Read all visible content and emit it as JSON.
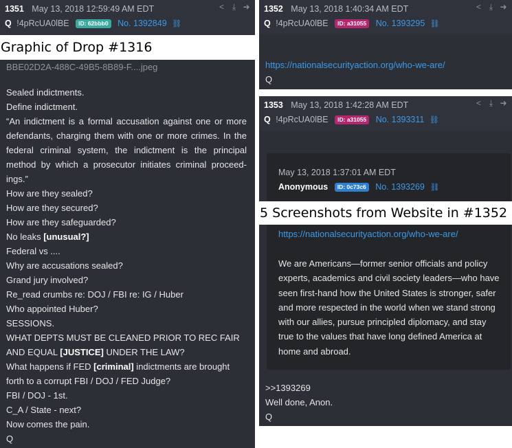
{
  "left_post": {
    "number": "1351",
    "datetime": "May 13, 2018 12:59:49 AM EDT",
    "author": "Q",
    "tripcode": "!4pRcUA0lBE",
    "id_badge": "ID: 62bbb0",
    "id_color": "#3aa99f",
    "post_link": "No. 1392849",
    "filename": "BBE02D2A-488C-49B5-8B89-F....jpeg",
    "lines": {
      "l1": "Sealed indictments.",
      "l2": "Define indictment.",
      "l3": "“An indictment is a formal accusation against one or more defendants, charging them with one or more crimes. In the federal criminal system, the indictment is the principal method by which a prosecutor initiates criminal proceed- ings.”",
      "l4": "How are they sealed?",
      "l5": "How are they secured?",
      "l6": "How are they safeguarded?",
      "l7a": "No leaks ",
      "l7b": "[unusual?]",
      "l8": "Federal vs ....",
      "l9": "Why are accusations sealed?",
      "l10": "Grand jury involved?",
      "l11": "Re_read crumbs re: DOJ / FBI re: IG / Huber",
      "l12": "Who appointed Huber?",
      "l13": "SESSIONS.",
      "l14a": "WHAT DEPTS MUST BE CLEANED PRIOR TO REC FAIR AND EQUAL ",
      "l14b": "[JUSTICE]",
      "l14c": " UNDER THE LAW?",
      "l15a": "What happens if FED ",
      "l15b": "[criminal]",
      "l15c": " indictments are brought forth to a corrupt FBI / DOJ / FED Judge?",
      "l16": "FBI / DOJ - 1st.",
      "l17": "C_A / State - next?",
      "l18": "Now comes the pain.",
      "l19": "Q"
    }
  },
  "label_left": "Graphic of Drop #1316",
  "label_right": "5 Screenshots from Website in #1352",
  "post_1352": {
    "number": "1352",
    "datetime": "May 13, 2018 1:40:34 AM EDT",
    "author": "Q",
    "tripcode": "!4pRcUA0lBE",
    "id_badge": "ID: a31055",
    "id_color": "#b8256f",
    "post_link": "No. 1393295",
    "url": "https://nationalsecurityaction.org/who-we-are/",
    "sign": "Q"
  },
  "post_1353": {
    "number": "1353",
    "datetime": "May 13, 2018 1:42:28 AM EDT",
    "author": "Q",
    "tripcode": "!4pRcUA0lBE",
    "id_badge": "ID: a31055",
    "id_color": "#b8256f",
    "post_link": "No. 1393311",
    "quoted": {
      "datetime": "May 13, 2018 1:37:01 AM EDT",
      "author": "Anonymous",
      "id_badge": "ID: 0c73c6",
      "id_color": "#2f7fd0",
      "post_link": "No. 1393269",
      "url": "https://nationalsecurityaction.org/who-we-are/",
      "text": "We are Americans—former senior officials and policy experts, academics and civil society leaders—who have seen first-hand how the United States is stronger, safer and more respected in the world when we stand strong with our allies, pursue principled diplomacy, and stay true to the values that have long defined America at home and abroad."
    },
    "reply_ref": ">>1393269",
    "reply_text": "Well done, Anon.",
    "sign": "Q"
  },
  "icons": [
    "share-icon",
    "download-icon",
    "arrow-right-icon",
    "link-icon"
  ]
}
